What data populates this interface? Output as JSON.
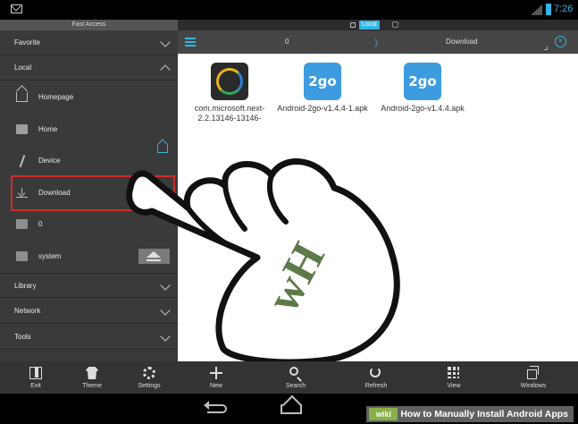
{
  "status_bar": {
    "time": "7:26"
  },
  "sidebar": {
    "header": "Fast Access",
    "groups": {
      "favorite": "Favorite",
      "local": "Local",
      "library": "Library",
      "network": "Network",
      "tools": "Tools"
    },
    "local_items": [
      {
        "label": "Homepage",
        "icon": "house-icon"
      },
      {
        "label": "Home",
        "icon": "folder-icon"
      },
      {
        "label": "Device",
        "icon": "slash-icon"
      },
      {
        "label": "Download",
        "icon": "download-icon"
      },
      {
        "label": "0",
        "icon": "sdcard-icon"
      },
      {
        "label": "system",
        "icon": "sdcard-icon"
      }
    ]
  },
  "tabs": {
    "active": "Local"
  },
  "path_bar": {
    "root": "0",
    "current": "Download"
  },
  "files": [
    {
      "name": "com.microsoft.next-2.2.13146-13146-",
      "icon": "app-icon"
    },
    {
      "name": "Android-2go-v1.4.4-1.apk",
      "icon_text": "2go"
    },
    {
      "name": "Android-2go-v1.4.4.apk",
      "icon_text": "2go"
    }
  ],
  "bottom_toolbar": {
    "left": [
      "Exit",
      "Theme",
      "Settings"
    ],
    "right": [
      "New",
      "Search",
      "Refresh",
      "View",
      "Windows"
    ]
  },
  "watermark": {
    "logo": "wiki",
    "text": "How to Manually Install Android Apps"
  },
  "hand_logo": "wH",
  "colors": {
    "accent": "#33b5e5",
    "highlight": "#d42a2a",
    "wiki_green": "#8ab04a"
  }
}
